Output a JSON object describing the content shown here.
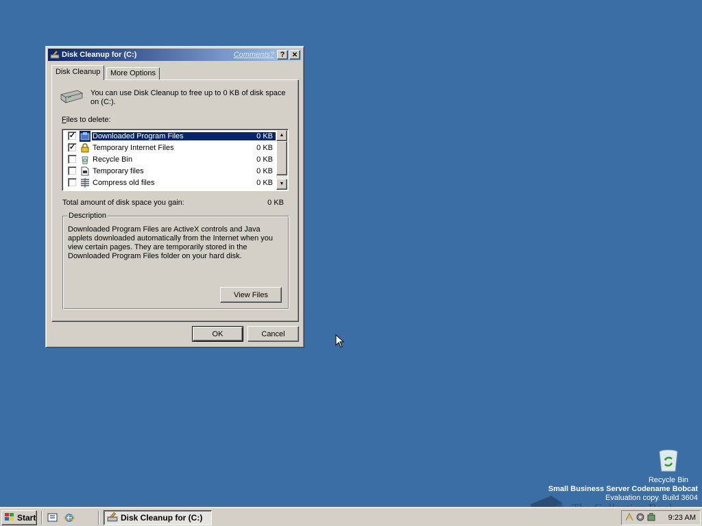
{
  "window": {
    "title": "Disk Cleanup for  (C:)",
    "comments_link": "Comments?",
    "help_btn": "?",
    "close_btn": "✕"
  },
  "tabs": [
    {
      "label": "Disk Cleanup",
      "active": true
    },
    {
      "label": "More Options",
      "active": false
    }
  ],
  "intro": {
    "text": "You can use Disk Cleanup to free up to 0 KB of disk space on  (C:)."
  },
  "files_label": {
    "prefix": "F",
    "rest": "iles to delete:"
  },
  "files": [
    {
      "name": "Downloaded Program Files",
      "size": "0 KB",
      "checked": true,
      "selected": true,
      "icon": "downloaded-programs-icon"
    },
    {
      "name": "Temporary Internet Files",
      "size": "0 KB",
      "checked": true,
      "selected": false,
      "icon": "lock-icon"
    },
    {
      "name": "Recycle Bin",
      "size": "0 KB",
      "checked": false,
      "selected": false,
      "icon": "recycle-bin-icon"
    },
    {
      "name": "Temporary files",
      "size": "0 KB",
      "checked": false,
      "selected": false,
      "icon": "temp-files-icon"
    },
    {
      "name": "Compress old files",
      "size": "0 KB",
      "checked": false,
      "selected": false,
      "icon": "compress-icon"
    }
  ],
  "total": {
    "label": "Total amount of disk space you gain:",
    "value": "0 KB"
  },
  "description": {
    "group_label": "Description",
    "text": "Downloaded Program Files are ActiveX controls and Java applets downloaded automatically from the Internet when you view certain pages. They are temporarily stored in the Downloaded Program Files folder on your hard disk.",
    "view_files_label": "View Files"
  },
  "buttons": {
    "ok": "OK",
    "cancel": "Cancel"
  },
  "desktop": {
    "recycle_bin_label": "Recycle Bin",
    "watermark_line1": "Small Business Server Codename Bobcat",
    "watermark_line2": "Evaluation copy. Build 3604",
    "overlay_text": "The Collection Book"
  },
  "taskbar": {
    "start_label": "Start",
    "task_label": "Disk Cleanup for  (C:)",
    "clock": "9:23 AM"
  },
  "colors": {
    "desktop": "#3a6ea5",
    "title_active_start": "#0a246a",
    "title_active_end": "#a6caf0",
    "selection": "#0a246a",
    "face": "#d4d0c8"
  }
}
